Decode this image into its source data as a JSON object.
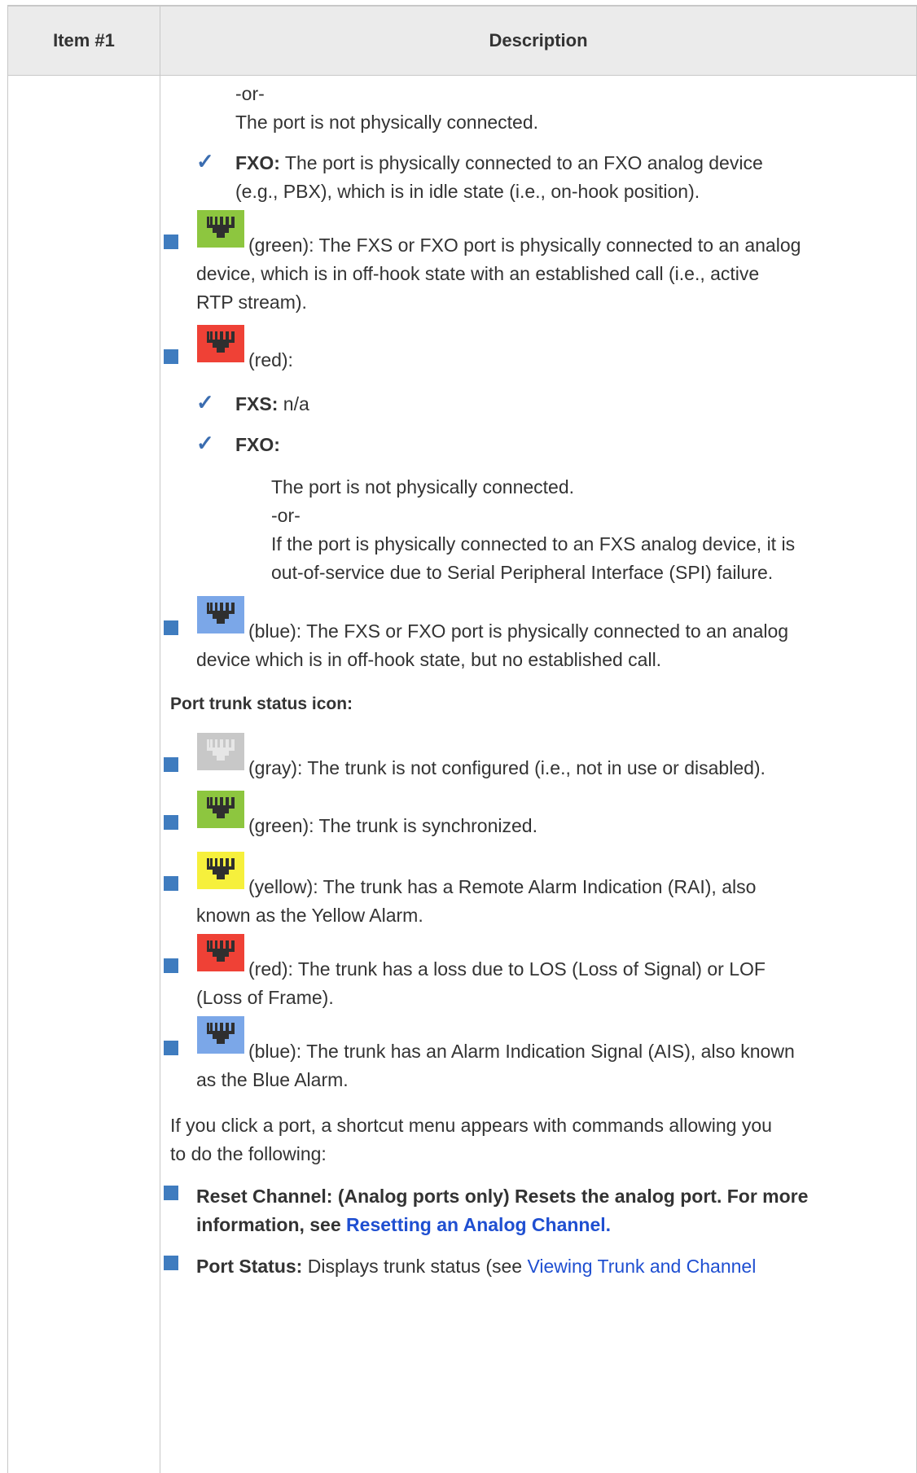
{
  "table": {
    "col1_header": "Item #1",
    "col2_header": "Description"
  },
  "fxo_idle": {
    "or_text": "-or-",
    "not_connected": "The port is not physically connected.",
    "fxo_label": "FXO:",
    "fxo_text_line1": " The port is physically connected to an FXO analog device",
    "fxo_text_line2": "(e.g., PBX), which is in idle state (i.e., on-hook position)."
  },
  "green_item": {
    "line1": "(green): The FXS or FXO port is physically connected to an analog",
    "line2": "device, which is in off-hook state with an established call (i.e., active",
    "line3": "RTP stream)."
  },
  "red_item": {
    "label": "(red):",
    "fxs_label": "FXS:",
    "fxs_text": " n/a",
    "fxo_label": "FXO:",
    "sub_line1": "The port is not physically connected.",
    "sub_or": "-or-",
    "sub_line2": "If the port is physically connected to an FXS analog device, it is",
    "sub_line3": "out-of-service due to Serial Peripheral Interface (SPI) failure."
  },
  "blue_item": {
    "line1": "(blue): The FXS or FXO port is physically connected to an analog",
    "line2": "device which is in off-hook state, but no established call."
  },
  "trunk": {
    "heading": "Port trunk status icon:",
    "gray": "(gray): The trunk is not configured (i.e., not in use or disabled).",
    "green": "(green): The trunk is synchronized.",
    "yellow_line1": "(yellow): The trunk has a Remote Alarm Indication (RAI), also",
    "yellow_line2": "known as the Yellow Alarm.",
    "red_line1": "(red): The trunk has a loss due to LOS (Loss of Signal) or LOF",
    "red_line2": "(Loss of Frame).",
    "blue_line1": "(blue): The trunk has an Alarm Indication Signal (AIS), also known",
    "blue_line2": "as the Blue Alarm."
  },
  "click_para": {
    "line1": "If you click a port, a shortcut menu appears with commands allowing you",
    "line2": "to do the following:"
  },
  "reset": {
    "line1": "Reset Channel: (Analog ports only) Resets the analog port. For more",
    "line2_prefix": "information, see ",
    "link": "Resetting an Analog Channel."
  },
  "port_status": {
    "label": "Port Status:",
    "text": " Displays trunk status (see ",
    "link": "Viewing Trunk and Channel"
  },
  "icon_colors": {
    "green": "#8dc63f",
    "red": "#ef4136",
    "blue": "#7ba7e8",
    "gray": "#c8c8c8",
    "yellow": "#f6f03c",
    "bullet": "#3f7cbf",
    "check": "#3b6db0"
  },
  "icons": {
    "green": "port-connector-icon",
    "red": "port-connector-icon",
    "blue": "port-connector-icon",
    "gray": "port-connector-icon",
    "yellow": "port-connector-icon"
  }
}
